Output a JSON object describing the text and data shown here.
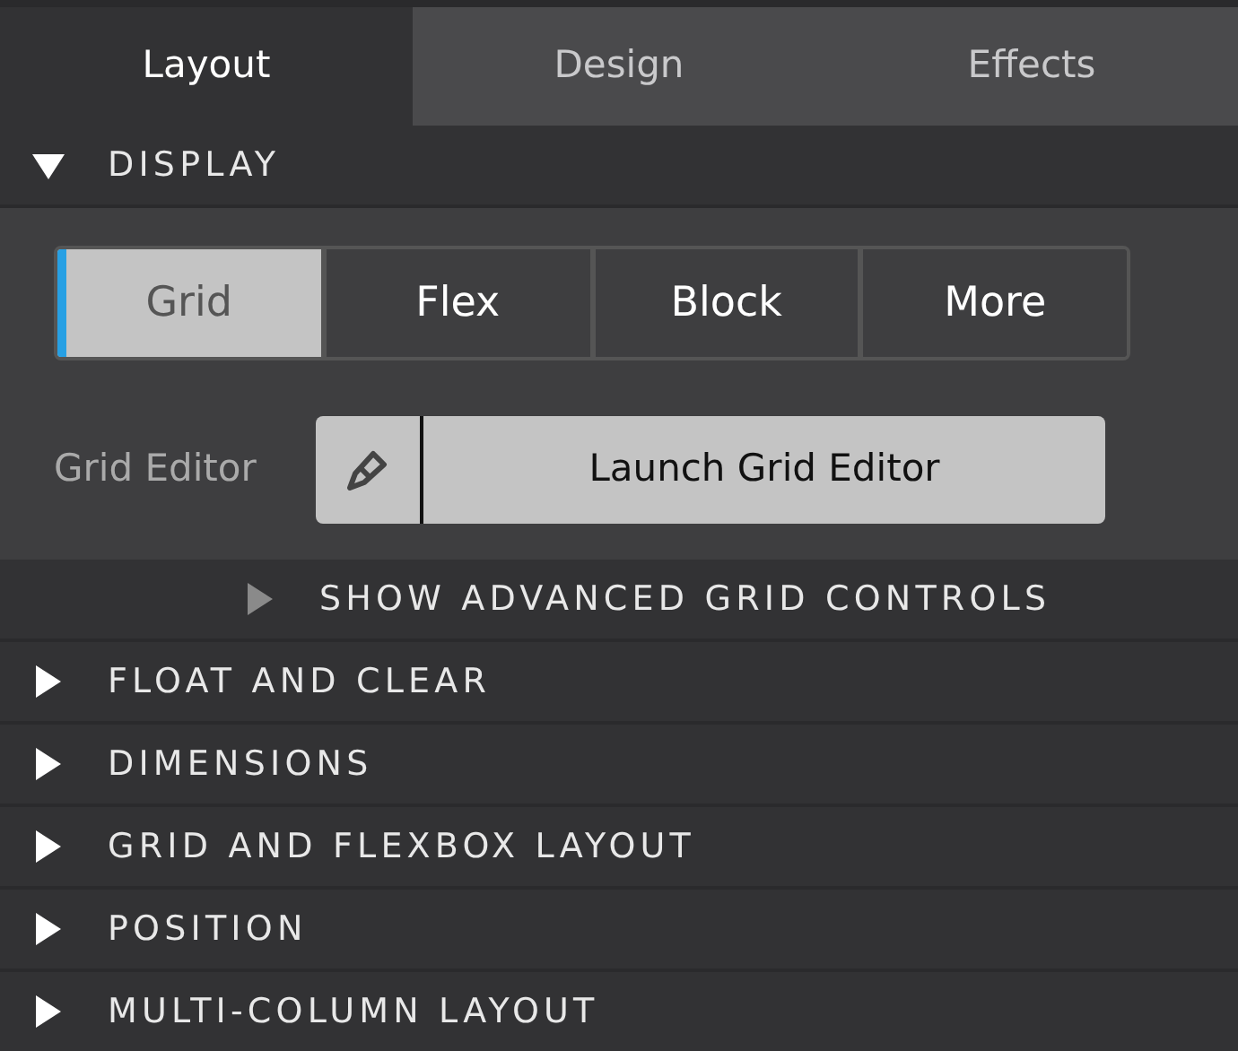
{
  "tabs": [
    {
      "label": "Layout",
      "selected": true
    },
    {
      "label": "Design",
      "selected": false
    },
    {
      "label": "Effects",
      "selected": false
    }
  ],
  "display": {
    "title": "DISPLAY",
    "expanded": true,
    "modes": [
      {
        "label": "Grid",
        "selected": true
      },
      {
        "label": "Flex",
        "selected": false
      },
      {
        "label": "Block",
        "selected": false
      },
      {
        "label": "More",
        "selected": false
      }
    ],
    "grid_editor": {
      "label": "Grid Editor",
      "button": "Launch Grid Editor"
    },
    "advanced": {
      "title": "SHOW ADVANCED GRID CONTROLS",
      "expanded": false
    }
  },
  "sections": [
    {
      "title": "FLOAT AND CLEAR",
      "expanded": false
    },
    {
      "title": "DIMENSIONS",
      "expanded": false
    },
    {
      "title": "GRID AND FLEXBOX LAYOUT",
      "expanded": false
    },
    {
      "title": "POSITION",
      "expanded": false
    },
    {
      "title": "MULTI-COLUMN LAYOUT",
      "expanded": false
    }
  ]
}
